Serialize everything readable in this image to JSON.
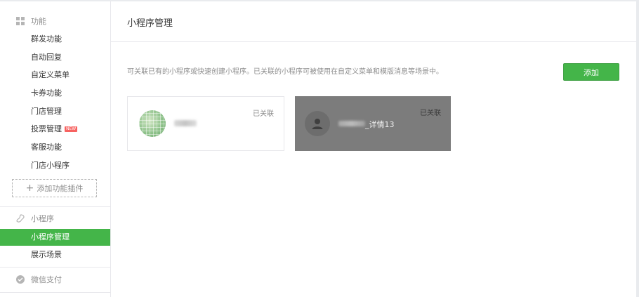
{
  "sidebar": {
    "features_group": {
      "label": "功能",
      "icon": "grid-icon"
    },
    "features_items": [
      {
        "label": "群发功能"
      },
      {
        "label": "自动回复"
      },
      {
        "label": "自定义菜单"
      },
      {
        "label": "卡券功能"
      },
      {
        "label": "门店管理"
      },
      {
        "label": "投票管理",
        "badge": "NEW"
      },
      {
        "label": "客服功能"
      },
      {
        "label": "门店小程序"
      }
    ],
    "add_plugin_label": "添加功能插件",
    "miniprogram_group": {
      "label": "小程序",
      "icon": "miniprogram-icon"
    },
    "miniprogram_items": [
      {
        "label": "小程序管理",
        "active": true
      },
      {
        "label": "展示场景"
      }
    ],
    "pay_group": {
      "label": "微信支付",
      "icon": "wechat-pay-icon"
    }
  },
  "main": {
    "title": "小程序管理",
    "description": "可关联已有的小程序或快速创建小程序。已关联的小程序可被使用在自定义菜单和模版消息等场景中。",
    "add_button": "添加",
    "cards": [
      {
        "status": "已关联",
        "avatar": "qr-avatar"
      },
      {
        "status": "已关联",
        "avatar": "person-icon",
        "name_visible": "_详情13"
      }
    ]
  },
  "colors": {
    "brand_green": "#44b549",
    "border": "#e7e7eb",
    "muted_text": "#8d8d8d",
    "selected_card_bg": "#7c7c7c"
  }
}
